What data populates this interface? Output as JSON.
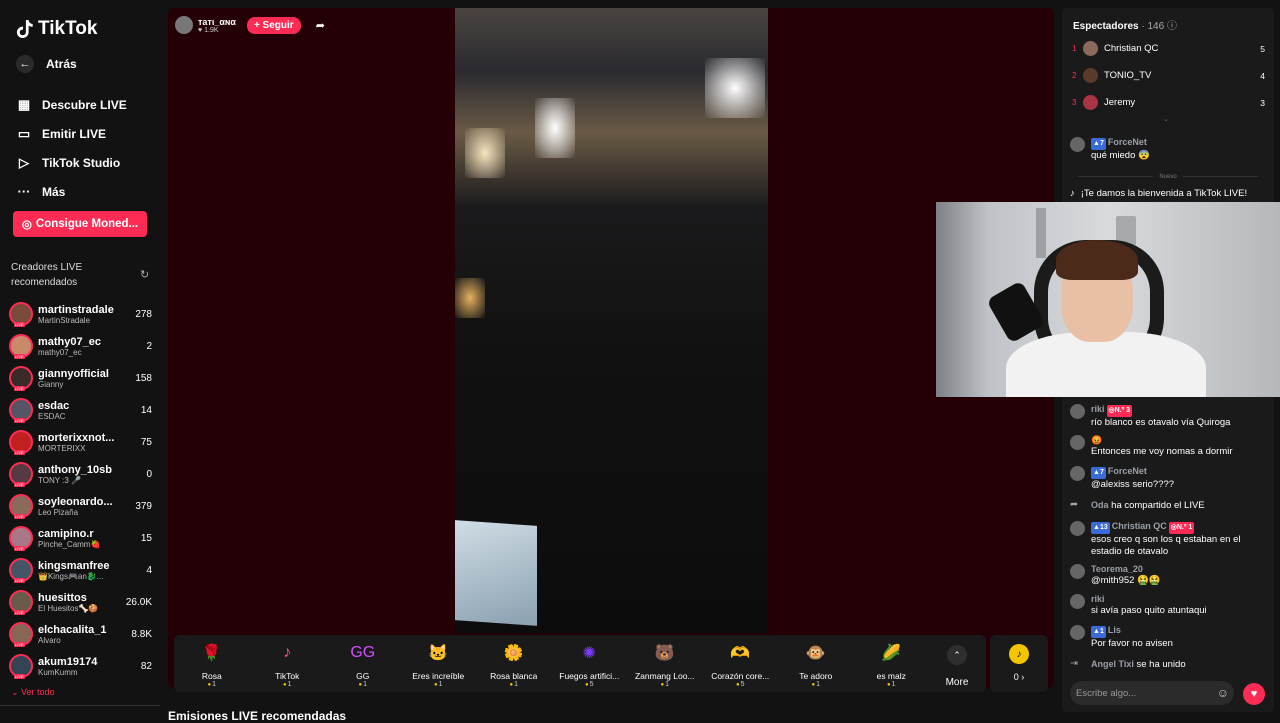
{
  "app": {
    "name": "TikTok"
  },
  "sidebar": {
    "back_label": "Atrás",
    "nav": [
      {
        "icon": "live-calendar-icon",
        "label": "Descubre LIVE"
      },
      {
        "icon": "video-camera-icon",
        "label": "Emitir LIVE"
      },
      {
        "icon": "studio-play-icon",
        "label": "TikTok Studio"
      },
      {
        "icon": "more-dots-icon",
        "label": "Más"
      }
    ],
    "coins_button": "Consigue Moned...",
    "recommended_title": "Creadores LIVE recomendados",
    "creators": [
      {
        "name": "martinstradale",
        "sub": "MartinStradale",
        "count": "278"
      },
      {
        "name": "mathy07_ec",
        "sub": "mathy07_ec",
        "count": "2"
      },
      {
        "name": "giannyofficial",
        "sub": "Gianny",
        "count": "158"
      },
      {
        "name": "esdac",
        "sub": "ESDAC",
        "count": "14"
      },
      {
        "name": "morterixxnot...",
        "sub": "MORTERIXX",
        "count": "75"
      },
      {
        "name": "anthony_10sb",
        "sub": "TONY :3 🎤",
        "count": "0"
      },
      {
        "name": "soyleonardo...",
        "sub": "Leo Pizaña",
        "count": "379"
      },
      {
        "name": "camipino.r",
        "sub": "Pinche_Camm🍓",
        "count": "15"
      },
      {
        "name": "kingsmanfree",
        "sub": "👑Kings🎮an🐉...",
        "count": "4"
      },
      {
        "name": "huesittos",
        "sub": "El Huesitos🦴🍪",
        "count": "26.0K"
      },
      {
        "name": "elchacalita_1",
        "sub": "Alvaro",
        "count": "8.8K"
      },
      {
        "name": "akum19174",
        "sub": "KumKumm",
        "count": "82"
      }
    ],
    "see_all": "Ver todo"
  },
  "stream": {
    "host_name": "тaтι_αɴα",
    "host_likes": "1.9K",
    "follow_label": "+ Seguir"
  },
  "gifts": [
    {
      "name": "Rosa",
      "price": "1",
      "icon": "🌹",
      "color": "#c4213a"
    },
    {
      "name": "TikTok",
      "price": "1",
      "icon": "♪",
      "color": "#ff4fa8"
    },
    {
      "name": "GG",
      "price": "1",
      "icon": "GG",
      "color": "#d24dff"
    },
    {
      "name": "Eres increíble",
      "price": "1",
      "icon": "🐱",
      "color": "#c8955a"
    },
    {
      "name": "Rosa blanca",
      "price": "1",
      "icon": "🌼",
      "color": "#e9efe0"
    },
    {
      "name": "Fuegos artifici...",
      "price": "5",
      "icon": "✺",
      "color": "#7a3cff"
    },
    {
      "name": "Zanmang Loo...",
      "price": "1",
      "icon": "🐻",
      "color": "#ff9ac8"
    },
    {
      "name": "Corazón core...",
      "price": "5",
      "icon": "🫶",
      "color": "#ef8a7a"
    },
    {
      "name": "Te adoro",
      "price": "1",
      "icon": "🐵",
      "color": "#d9342e"
    },
    {
      "name": "es malz",
      "price": "1",
      "icon": "🌽",
      "color": "#f5c400"
    }
  ],
  "gifts_more": "More",
  "wallet_value": "0 ›",
  "recommended_heading": "Emisiones LIVE recomendadas",
  "chat": {
    "viewers_label": "Espectadores",
    "viewers_count": "· 146",
    "top_viewers": [
      {
        "rank": "1",
        "name": "Christian QC",
        "score": "5"
      },
      {
        "rank": "2",
        "name": "TONIO_TV",
        "score": "4"
      },
      {
        "rank": "3",
        "name": "Jeremy",
        "score": "3"
      }
    ],
    "new_divider": "Nuevo",
    "welcome": "¡Te damos la bienvenida a TikTok LIVE!",
    "messages": [
      {
        "badge": "7",
        "name": "ForceNet",
        "text": "qué miedo 😨"
      },
      {
        "name": "riki",
        "rbadge": "N.º 3",
        "text": "río blanco es otavalo vía Quiroga"
      },
      {
        "name": "😡",
        "text": "Entonces me voy nomas a dormir"
      },
      {
        "badge": "7",
        "name": "ForceNet",
        "text": "@alexiss serio????"
      },
      {
        "name": "Oda",
        "text": "ha compartido el LIVE"
      },
      {
        "badge": "13",
        "name": "Christian QC",
        "rbadge": "N.º 1",
        "text": "esos creo q son los q estaban en el estadio de otavalo"
      },
      {
        "name": "Teorema_20",
        "text": "@mith952 🤮🤮"
      },
      {
        "name": "riki",
        "text": "si avía paso quito atuntaqui"
      },
      {
        "badge": "1",
        "name": "Lis",
        "text": "Por favor no avisen"
      },
      {
        "name": "Angel Tixi",
        "text": "se ha unido"
      }
    ],
    "input_placeholder": "Escribe algo..."
  }
}
